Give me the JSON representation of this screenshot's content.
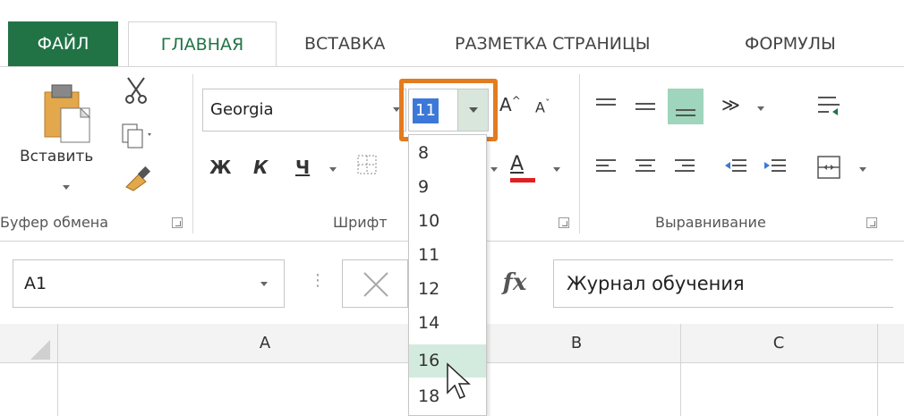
{
  "tabs": {
    "file": "ФАЙЛ",
    "home": "ГЛАВНАЯ",
    "insert": "ВСТАВКА",
    "page_layout": "РАЗМЕТКА СТРАНИЦЫ",
    "formulas": "ФОРМУЛЫ"
  },
  "clipboard": {
    "paste_label": "Вставить",
    "group_label": "Буфер обмена"
  },
  "font": {
    "font_name": "Georgia",
    "font_size": "11",
    "bold": "Ж",
    "italic": "К",
    "underline": "Ч",
    "group_label": "Шрифт"
  },
  "alignment": {
    "group_label": "Выравнивание"
  },
  "font_size_list": [
    "8",
    "9",
    "10",
    "11",
    "12",
    "14",
    "16",
    "18"
  ],
  "font_size_hovered": "16",
  "formula_bar": {
    "name_box": "A1",
    "fx_label": "fx",
    "formula": "Журнал обучения"
  },
  "columns": [
    "A",
    "B",
    "C"
  ],
  "colors": {
    "accent": "#217346",
    "highlight": "#e37b1f",
    "selection": "#3c78d8",
    "hover": "#d3ebdf",
    "font_color_bar": "#e02020"
  }
}
